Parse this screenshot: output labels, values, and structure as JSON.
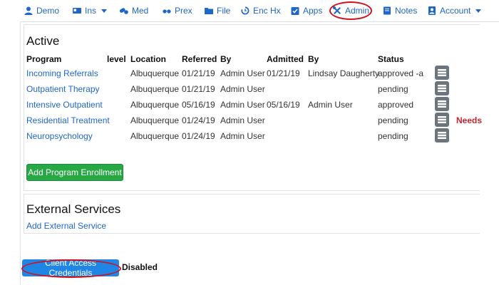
{
  "nav": {
    "items": [
      {
        "label": "Demo",
        "icon": "user-icon"
      },
      {
        "label": "Ins",
        "icon": "id-card-icon",
        "dropdown": true
      },
      {
        "label": "Med",
        "icon": "pills-icon"
      },
      {
        "label": "Prex",
        "icon": "glasses-icon"
      },
      {
        "label": "File",
        "icon": "folder-icon"
      },
      {
        "label": "Enc Hx",
        "icon": "history-icon"
      },
      {
        "label": "Apps",
        "icon": "checklist-icon"
      },
      {
        "label": "Admin",
        "icon": "tools-icon",
        "highlighted": true
      },
      {
        "label": "Notes",
        "icon": "notebook-icon"
      },
      {
        "label": "Account",
        "icon": "account-icon",
        "dropdown": true
      }
    ]
  },
  "active": {
    "title": "Active",
    "columns": [
      "Program",
      "level",
      "Location",
      "Referred",
      "By",
      "Admitted",
      "By",
      "Status"
    ],
    "rows": [
      {
        "program": "Incoming Referrals",
        "location": "Albuquerque",
        "referred": "01/21/19",
        "by": "Admin User",
        "admitted": "01/21/19",
        "admitted_by": "Lindsay Daugherty",
        "status": "approved -a",
        "note": ""
      },
      {
        "program": "Outpatient Therapy",
        "location": "Albuquerque",
        "referred": "01/21/19",
        "by": "Admin User",
        "admitted": "",
        "admitted_by": "",
        "status": "pending",
        "note": ""
      },
      {
        "program": "Intensive Outpatient",
        "location": "Albuquerque",
        "referred": "05/16/19",
        "by": "Admin User",
        "admitted": "05/16/19",
        "admitted_by": "Admin User",
        "status": "approved",
        "note": ""
      },
      {
        "program": "Residential Treatment",
        "location": "Albuquerque",
        "referred": "01/24/19",
        "by": "Admin User",
        "admitted": "",
        "admitted_by": "",
        "status": "pending",
        "note": "Needs"
      },
      {
        "program": "Neuropsychology",
        "location": "Albuquerque",
        "referred": "01/24/19",
        "by": "Admin User",
        "admitted": "",
        "admitted_by": "",
        "status": "pending",
        "note": ""
      }
    ],
    "add_button": "Add Program Enrollment"
  },
  "external": {
    "title": "External Services",
    "add_link": "Add External Service"
  },
  "credentials": {
    "button": "Client Access Credentials",
    "status": "Disabled"
  },
  "colors": {
    "link": "#1f66c9",
    "green": "#28a745",
    "blue": "#1f86e6",
    "warn": "#c82333",
    "annotation": "#d0121b"
  }
}
